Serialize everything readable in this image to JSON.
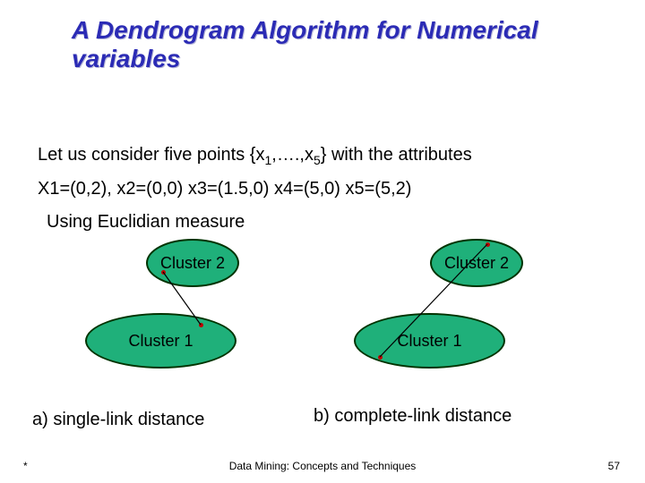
{
  "title": "A Dendrogram Algorithm for  Numerical variables",
  "intro_line1_a": "Let us consider five points {x",
  "intro_line1_b": ",….,x",
  "intro_line1_c": "} with the attributes",
  "intro_line2": "X1=(0,2), x2=(0,0) x3=(1.5,0) x4=(5,0) x5=(5,2)",
  "intro_line3": "Using Euclidian measure",
  "cluster2_label": "Cluster 2",
  "cluster1_label": "Cluster 1",
  "caption_a": "a) single-link distance",
  "caption_b": "b) complete-link distance",
  "footer_left": "*",
  "footer_center": "Data Mining: Concepts and Techniques",
  "footer_right": "57",
  "points": {
    "x1": [
      0,
      2
    ],
    "x2": [
      0,
      0
    ],
    "x3": [
      1.5,
      0
    ],
    "x4": [
      5,
      0
    ],
    "x5": [
      5,
      2
    ]
  },
  "sub1": "1",
  "sub5": "5"
}
